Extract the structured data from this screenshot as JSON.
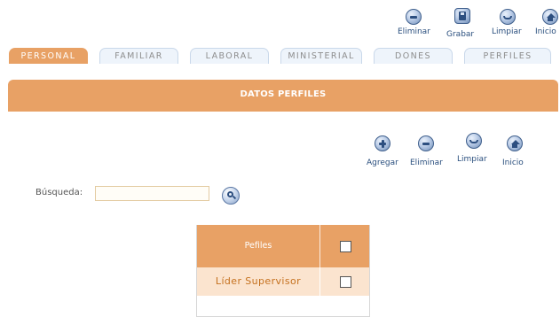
{
  "toolbar": {
    "eliminar": "Eliminar",
    "grabar": "Grabar",
    "limpiar": "Limpiar",
    "inicio": "Inicio"
  },
  "tabs": [
    {
      "label": "PERSONAL",
      "active": true
    },
    {
      "label": "FAMILIAR",
      "active": false
    },
    {
      "label": "LABORAL",
      "active": false
    },
    {
      "label": "MINISTERIAL",
      "active": false
    },
    {
      "label": "DONES",
      "active": false
    },
    {
      "label": "PERFILES",
      "active": false
    }
  ],
  "section": {
    "title": "DATOS PERFILES"
  },
  "actions": {
    "agregar": "Agregar",
    "eliminar": "Eliminar",
    "limpiar": "Limpiar",
    "inicio": "Inicio"
  },
  "search": {
    "label": "Búsqueda:",
    "value": ""
  },
  "table": {
    "header": "Pefiles",
    "rows": [
      {
        "label": "Líder Supervisor",
        "checked": false
      }
    ]
  },
  "colors": {
    "accent": "#e8a165",
    "row": "#fbe4cf",
    "link": "#2a4f7e"
  }
}
